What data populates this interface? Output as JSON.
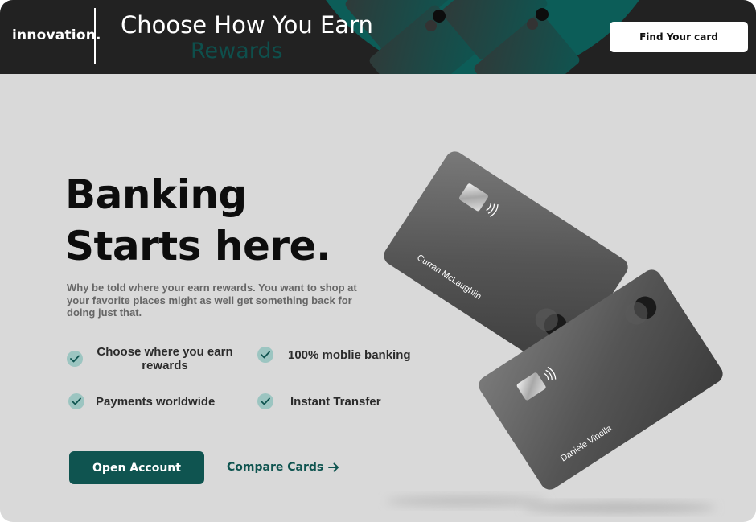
{
  "header": {
    "logo": "innovation.",
    "title": "Choose How You Earn",
    "subtitle": "Rewards",
    "find_button": "Find Your card"
  },
  "hero": {
    "title_line1": "Banking",
    "title_line2": "Starts here.",
    "description": "Why be told where your earn rewards. You want to shop at your favorite places might as well get something back for doing just that."
  },
  "features": [
    {
      "label": "Choose where you earn rewards"
    },
    {
      "label": "100% moblie banking"
    },
    {
      "label": "Payments worldwide"
    },
    {
      "label": "Instant Transfer"
    }
  ],
  "actions": {
    "open_account": "Open Account",
    "compare_cards": "Compare Cards"
  },
  "cards": [
    {
      "holder": "Curran McLaughlin"
    },
    {
      "holder": "Daniele Vinella"
    }
  ],
  "colors": {
    "accent": "#0f5450",
    "check_bg": "#9cc5c1",
    "header_bg": "#222222",
    "page_bg": "#d9d9d9"
  },
  "icons": {
    "check": "check-icon",
    "arrow": "arrow-right-icon",
    "chip": "chip-icon",
    "contactless": "contactless-icon"
  }
}
